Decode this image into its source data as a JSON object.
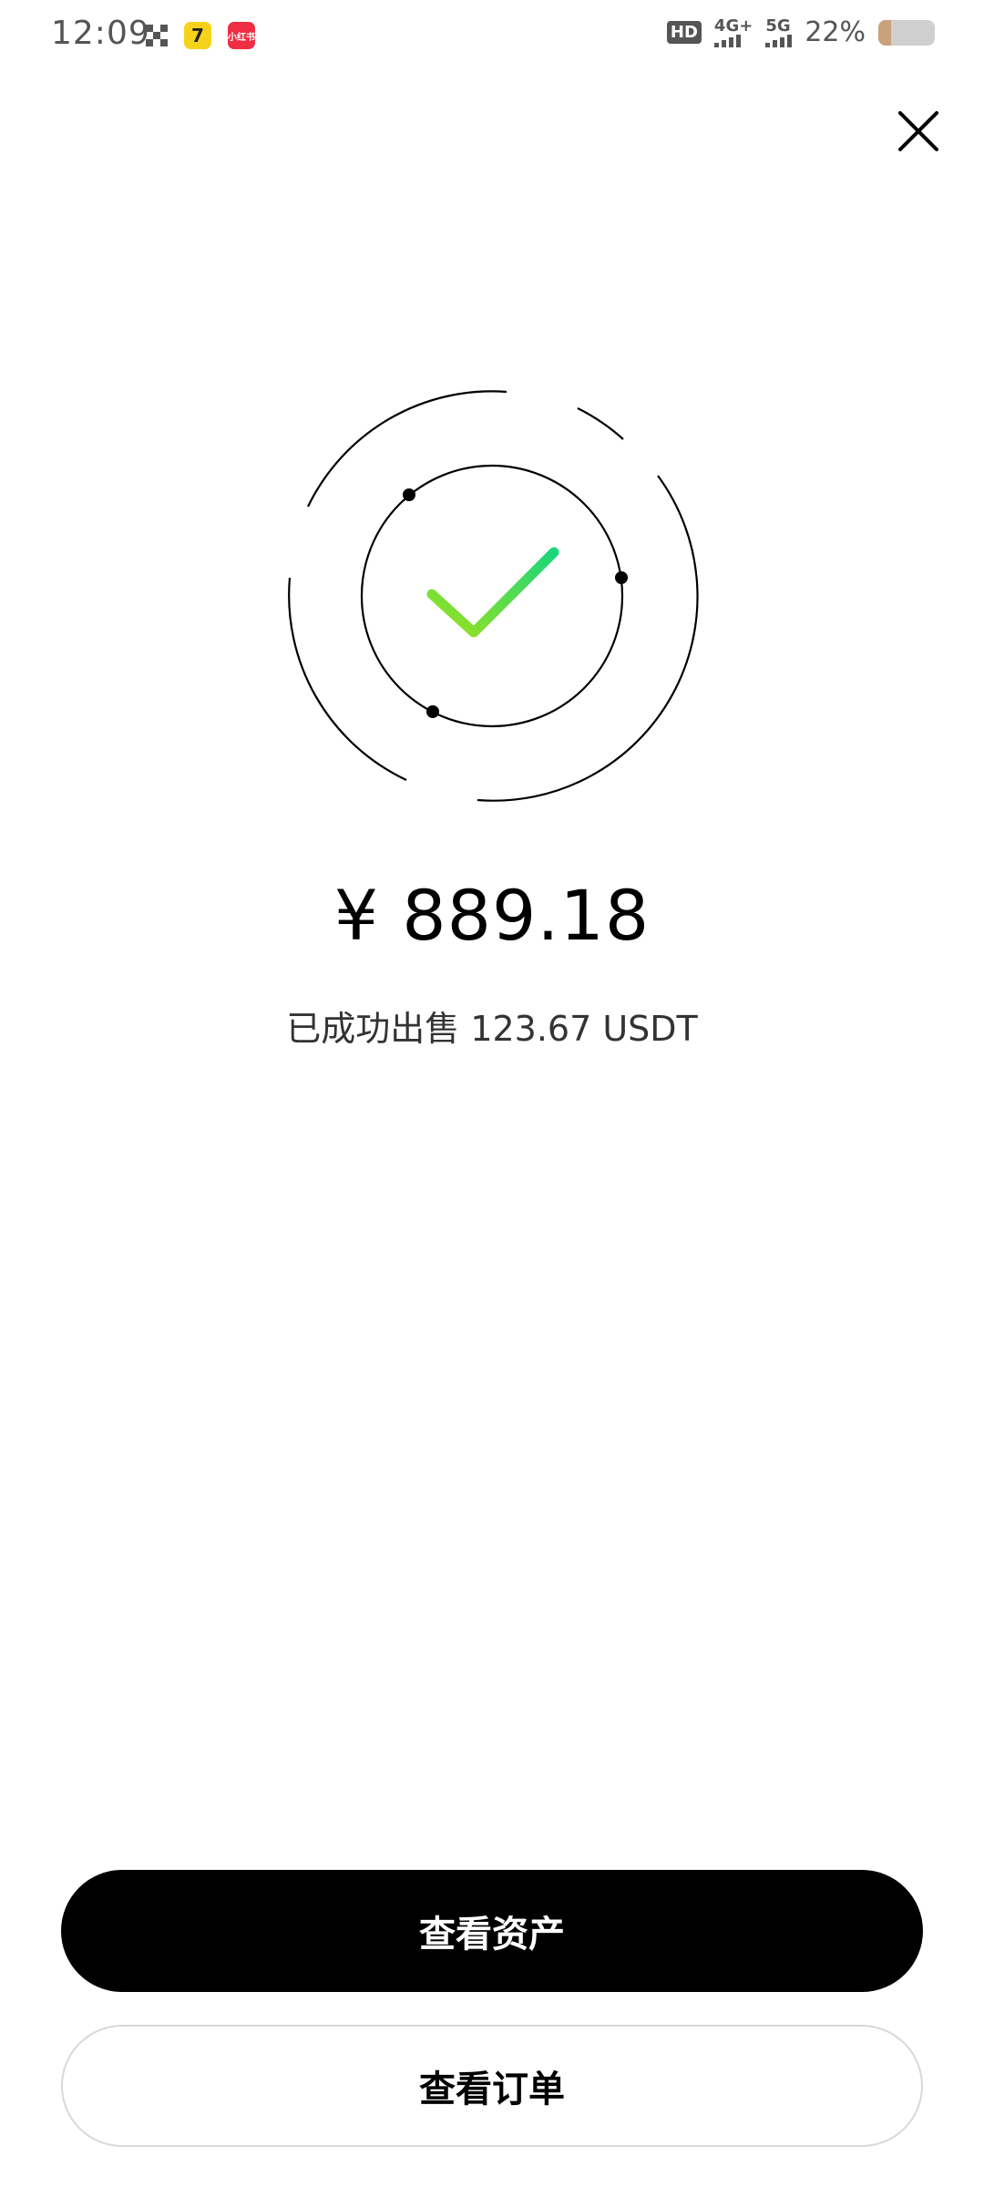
{
  "status_bar": {
    "time": "12:09",
    "hd_label": "HD",
    "sim1_network": "4G+",
    "sim2_network": "5G",
    "battery_percent_text": "22%",
    "battery_level": 0.22,
    "icons": [
      "grid-icon",
      "app-7-icon",
      "app-red-icon",
      "hd-icon",
      "signal-icon",
      "battery-icon"
    ],
    "app1_glyph": "7",
    "app2_glyph": "小红书"
  },
  "close_icon": "close-icon",
  "success": {
    "icon": "checkmark-icon",
    "check_gradient_start": "#9be21f",
    "check_gradient_end": "#1bd67a",
    "amount": "¥ 889.18",
    "message": "已成功出售 123.67 USDT"
  },
  "actions": {
    "view_assets_label": "查看资产",
    "view_orders_label": "查看订单"
  }
}
